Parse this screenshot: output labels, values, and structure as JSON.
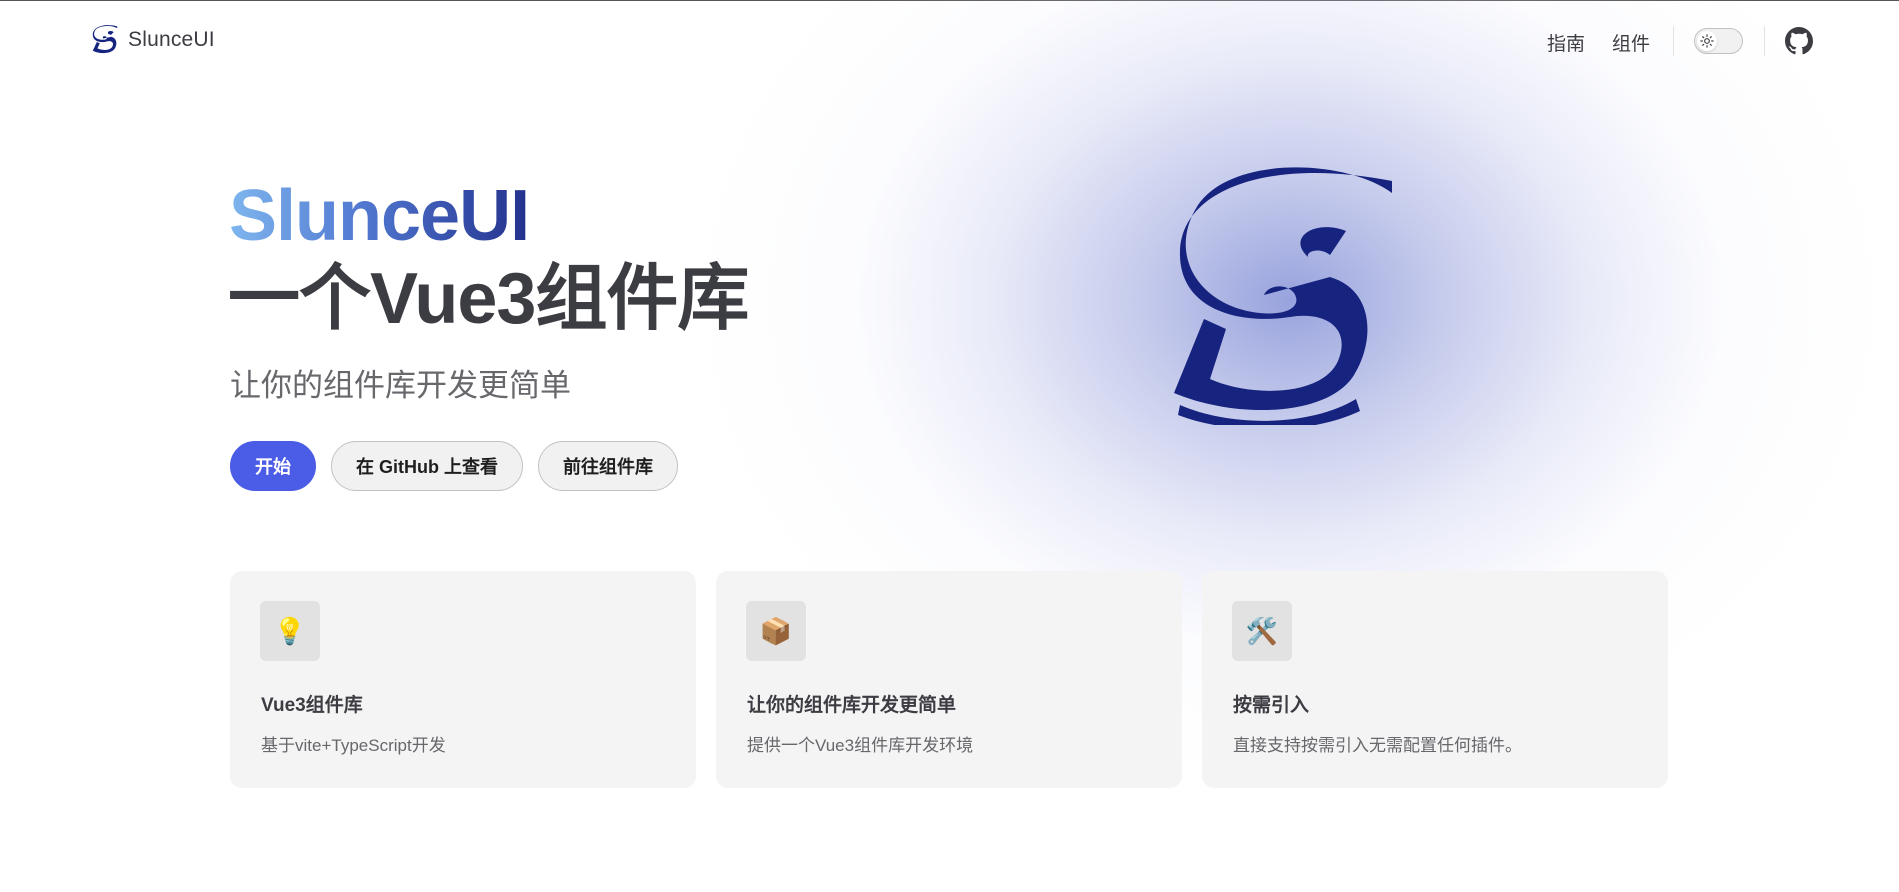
{
  "nav": {
    "brand_name": "SlunceUI",
    "links": [
      {
        "label": "指南"
      },
      {
        "label": "组件"
      }
    ],
    "theme_toggle_icon": "sun-icon",
    "github_icon": "github-icon"
  },
  "hero": {
    "name": "SlunceUI",
    "text": "一个Vue3组件库",
    "tagline": "让你的组件库开发更简单",
    "actions": [
      {
        "label": "开始",
        "theme": "brand"
      },
      {
        "label": "在 GitHub 上查看",
        "theme": "alt"
      },
      {
        "label": "前往组件库",
        "theme": "alt"
      }
    ]
  },
  "features": [
    {
      "icon": "💡",
      "icon_name": "lightbulb-icon",
      "title": "Vue3组件库",
      "details": "基于vite+TypeScript开发"
    },
    {
      "icon": "📦",
      "icon_name": "package-icon",
      "title": "让你的组件库开发更简单",
      "details": "提供一个Vue3组件库开发环境"
    },
    {
      "icon": "🛠️",
      "icon_name": "tools-icon",
      "title": "按需引入",
      "details": "直接支持按需引入无需配置任何插件。"
    }
  ],
  "colors": {
    "brand": "#4b5ce6",
    "logo": "#16237f",
    "gradient_start": "#7fb6ee",
    "gradient_end": "#23318c"
  }
}
